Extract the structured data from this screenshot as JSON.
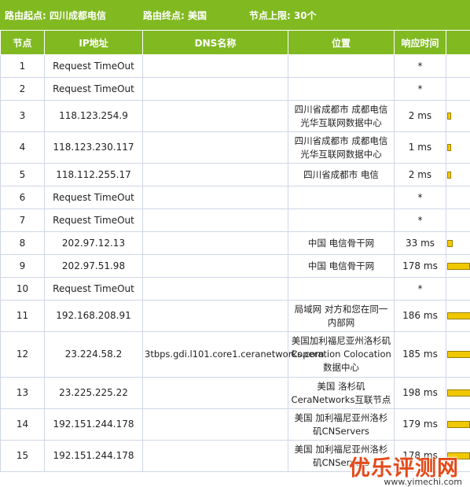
{
  "header": {
    "start_label": "路由起点: 四川成都电信",
    "end_label": "路由终点: 美国",
    "limit_label": "节点上限: 30个"
  },
  "columns": [
    "节点",
    "IP地址",
    "DNS名称",
    "位置",
    "响应时间"
  ],
  "bar_color": "#f0c800",
  "header_color": "#81b921",
  "rows": [
    {
      "hop": "1",
      "ip": "Request TimeOut",
      "dns": "",
      "loc": "",
      "time": "*",
      "bar": 0
    },
    {
      "hop": "2",
      "ip": "Request TimeOut",
      "dns": "",
      "loc": "",
      "time": "*",
      "bar": 0
    },
    {
      "hop": "3",
      "ip": "118.123.254.9",
      "dns": "",
      "loc": "四川省成都市 成都电信光华互联网数据中心",
      "time": "2 ms",
      "bar": 2
    },
    {
      "hop": "4",
      "ip": "118.123.230.117",
      "dns": "",
      "loc": "四川省成都市 成都电信光华互联网数据中心",
      "time": "1 ms",
      "bar": 1
    },
    {
      "hop": "5",
      "ip": "118.112.255.17",
      "dns": "",
      "loc": "四川省成都市 电信",
      "time": "2 ms",
      "bar": 2
    },
    {
      "hop": "6",
      "ip": "Request TimeOut",
      "dns": "",
      "loc": "",
      "time": "*",
      "bar": 0
    },
    {
      "hop": "7",
      "ip": "Request TimeOut",
      "dns": "",
      "loc": "",
      "time": "*",
      "bar": 0
    },
    {
      "hop": "8",
      "ip": "202.97.12.13",
      "dns": "",
      "loc": "中国 电信骨干网",
      "time": "33 ms",
      "bar": 33
    },
    {
      "hop": "9",
      "ip": "202.97.51.98",
      "dns": "",
      "loc": "中国 电信骨干网",
      "time": "178 ms",
      "bar": 178
    },
    {
      "hop": "10",
      "ip": "Request TimeOut",
      "dns": "",
      "loc": "",
      "time": "*",
      "bar": 0
    },
    {
      "hop": "11",
      "ip": "192.168.208.91",
      "dns": "",
      "loc": "局域网 对方和您在同一内部网",
      "time": "186 ms",
      "bar": 186
    },
    {
      "hop": "12",
      "ip": "23.224.58.2",
      "dns": "3tbps.gdi.l101.core1.ceranetworks.com",
      "loc": "美国加利福尼亚州洛杉矶 Coperation Colocation数据中心",
      "time": "185 ms",
      "bar": 185
    },
    {
      "hop": "13",
      "ip": "23.225.225.22",
      "dns": "",
      "loc": "美国 洛杉矶CeraNetworks互联节点",
      "time": "198 ms",
      "bar": 198
    },
    {
      "hop": "14",
      "ip": "192.151.244.178",
      "dns": "",
      "loc": "美国 加利福尼亚州洛杉矶CNServers",
      "time": "179 ms",
      "bar": 179
    },
    {
      "hop": "15",
      "ip": "192.151.244.178",
      "dns": "",
      "loc": "美国 加利福尼亚州洛杉矶CNServers",
      "time": "178 ms",
      "bar": 178
    }
  ],
  "watermark": {
    "text": "优乐评测网",
    "url": "www.yimechi.com"
  }
}
